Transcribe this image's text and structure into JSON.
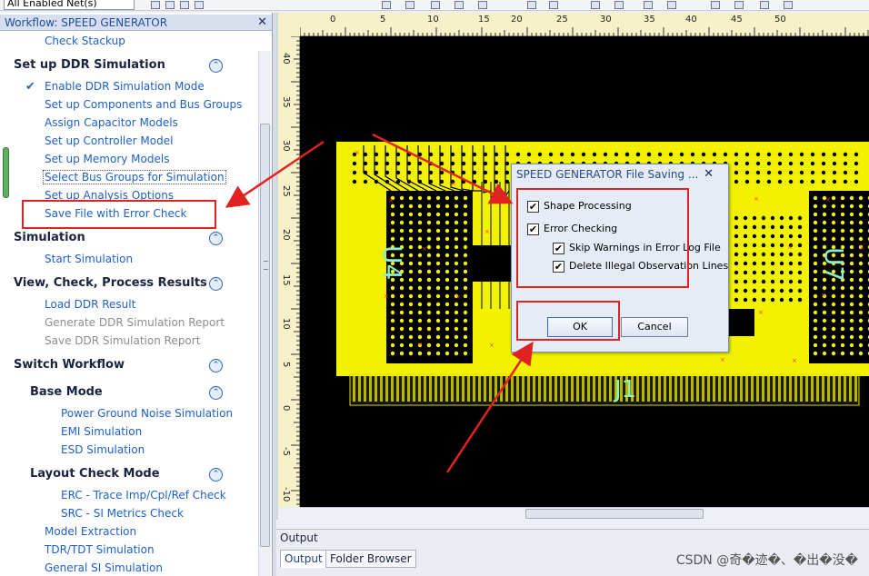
{
  "toolbar": {
    "net_filter": "All Enabled Net(s)"
  },
  "workflow": {
    "title": "Workflow: SPEED GENERATOR",
    "close_glyph": "✕",
    "top_item": "Check Stackup",
    "sections": {
      "ddr_setup": {
        "title": "Set up DDR Simulation",
        "items": [
          "Enable DDR Simulation Mode",
          "Set up Components and Bus Groups",
          "Assign Capacitor Models",
          "Set up Controller Model",
          "Set up Memory Models",
          "Select Bus Groups for Simulation",
          "Set up Analysis Options",
          "Save File with Error Check"
        ]
      },
      "simulation": {
        "title": "Simulation",
        "items": [
          "Start Simulation"
        ]
      },
      "results": {
        "title": "View, Check, Process Results",
        "items": [
          "Load DDR Result",
          "Generate DDR Simulation Report",
          "Save DDR Simulation Report"
        ]
      },
      "switch": {
        "title": "Switch Workflow"
      },
      "base_mode": {
        "title": "Base Mode",
        "items": [
          "Power Ground Noise Simulation",
          "EMI Simulation",
          "ESD Simulation"
        ]
      },
      "layout_check": {
        "title": "Layout Check Mode",
        "items": [
          "ERC - Trace Imp/Cpl/Ref Check",
          "SRC - SI Metrics Check"
        ]
      },
      "tail_items": [
        "Model Extraction",
        "TDR/TDT Simulation",
        "General SI Simulation"
      ]
    },
    "collapse_glyph": "⌃",
    "check_glyph": "✔"
  },
  "ruler": {
    "top_ticks": [
      "0",
      "5",
      "10",
      "15",
      "20",
      "25",
      "30",
      "35",
      "40",
      "45",
      "50"
    ],
    "left_ticks": [
      "40",
      "35",
      "30",
      "25",
      "20",
      "15",
      "10",
      "5",
      "0",
      "-5",
      "-10"
    ]
  },
  "board": {
    "labels": [
      "U4",
      "U7",
      "J1"
    ],
    "colors": {
      "copper": "#f2f200",
      "background": "#000000",
      "label": "#8ef0c8"
    }
  },
  "dialog": {
    "title": "SPEED GENERATOR File Saving ...",
    "close_glyph": "✕",
    "shape_processing": "Shape Processing",
    "error_checking": "Error Checking",
    "skip_warnings": "Skip Warnings in Error Log File",
    "delete_illegal": "Delete Illegal Observation Lines",
    "checked_glyph": "✔",
    "ok_label": "OK",
    "cancel_label": "Cancel"
  },
  "output": {
    "title": "Output",
    "tabs": [
      "Output",
      "Folder Browser"
    ],
    "watermark": "CSDN @奇�迹�、�出�没�"
  },
  "annotation_color": "#e02222"
}
